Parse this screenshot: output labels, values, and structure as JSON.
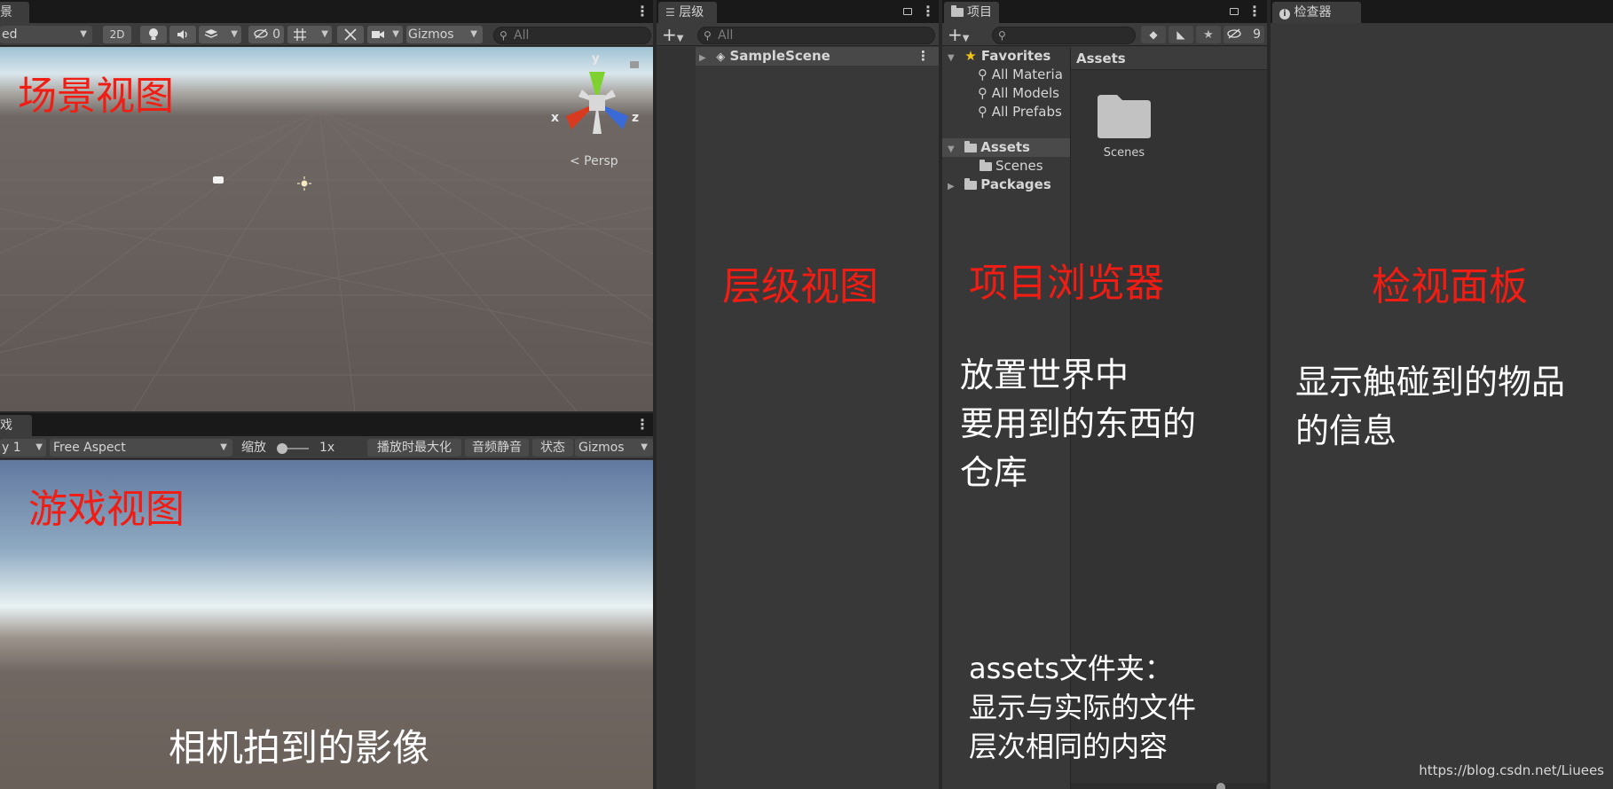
{
  "scene": {
    "tab_label": "景",
    "shading_mode": "ed",
    "btn_2d": "2D",
    "hidden_count": "0",
    "gizmos_label": "Gizmos",
    "search_placeholder": "All",
    "axis_x": "x",
    "axis_y": "y",
    "axis_z": "z",
    "persp_label": "< Persp",
    "annotation": "场景视图"
  },
  "game": {
    "tab_label": "戏",
    "display_label": "y 1",
    "aspect_label": "Free Aspect",
    "scale_label": "缩放",
    "scale_value": "1x",
    "maximize_label": "播放时最大化",
    "mute_label": "音频静音",
    "stats_label": "状态",
    "gizmos_label": "Gizmos",
    "annotation_title": "游戏视图",
    "annotation_desc": "相机拍到的影像"
  },
  "hierarchy": {
    "tab_label": "层级",
    "search_placeholder": "All",
    "scene_item": "SampleScene",
    "annotation": "层级视图"
  },
  "project": {
    "tab_label": "项目",
    "hidden_count": "9",
    "favorites_label": "Favorites",
    "favorites": [
      "All Materia",
      "All Models",
      "All Prefabs"
    ],
    "assets_label": "Assets",
    "scenes_label": "Scenes",
    "packages_label": "Packages",
    "breadcrumb": "Assets",
    "grid_folder": "Scenes",
    "annotation_title": "项目浏览器",
    "annotation_desc": [
      "放置世界中",
      "要用到的东西的",
      "仓库"
    ],
    "annotation_assets": [
      "assets文件夹：",
      "显示与实际的文件",
      "层次相同的内容"
    ]
  },
  "inspector": {
    "tab_label": "检查器",
    "annotation_title": "检视面板",
    "annotation_desc": [
      "显示触碰到的物品",
      "的信息"
    ]
  },
  "watermark": "https://blog.csdn.net/Liuees",
  "colors": {
    "annotation_red": "#f01d14",
    "panel_bg": "#383838",
    "tabbar_bg": "#191919",
    "toolbar_bg": "#3c3c3c"
  }
}
